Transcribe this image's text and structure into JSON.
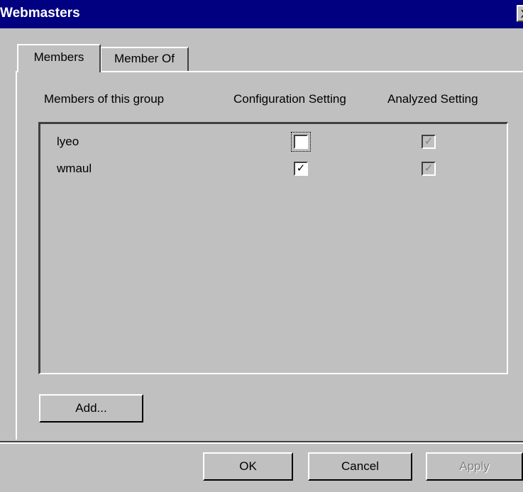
{
  "window": {
    "title": "Webmasters",
    "close_glyph": "X"
  },
  "tabs": [
    {
      "label": "Members",
      "active": true
    },
    {
      "label": "Member Of",
      "active": false
    }
  ],
  "columns": {
    "members": "Members of this group",
    "configuration": "Configuration Setting",
    "analyzed": "Analyzed Setting"
  },
  "members": [
    {
      "name": "lyeo",
      "configuration_checked": false,
      "analyzed_checked": true,
      "configuration_glyph": "",
      "analyzed_glyph": "✓"
    },
    {
      "name": "wmaul",
      "configuration_checked": true,
      "analyzed_checked": true,
      "configuration_glyph": "✓",
      "analyzed_glyph": "✓"
    }
  ],
  "buttons": {
    "add": "Add...",
    "ok": "OK",
    "cancel": "Cancel",
    "apply": "Apply"
  }
}
